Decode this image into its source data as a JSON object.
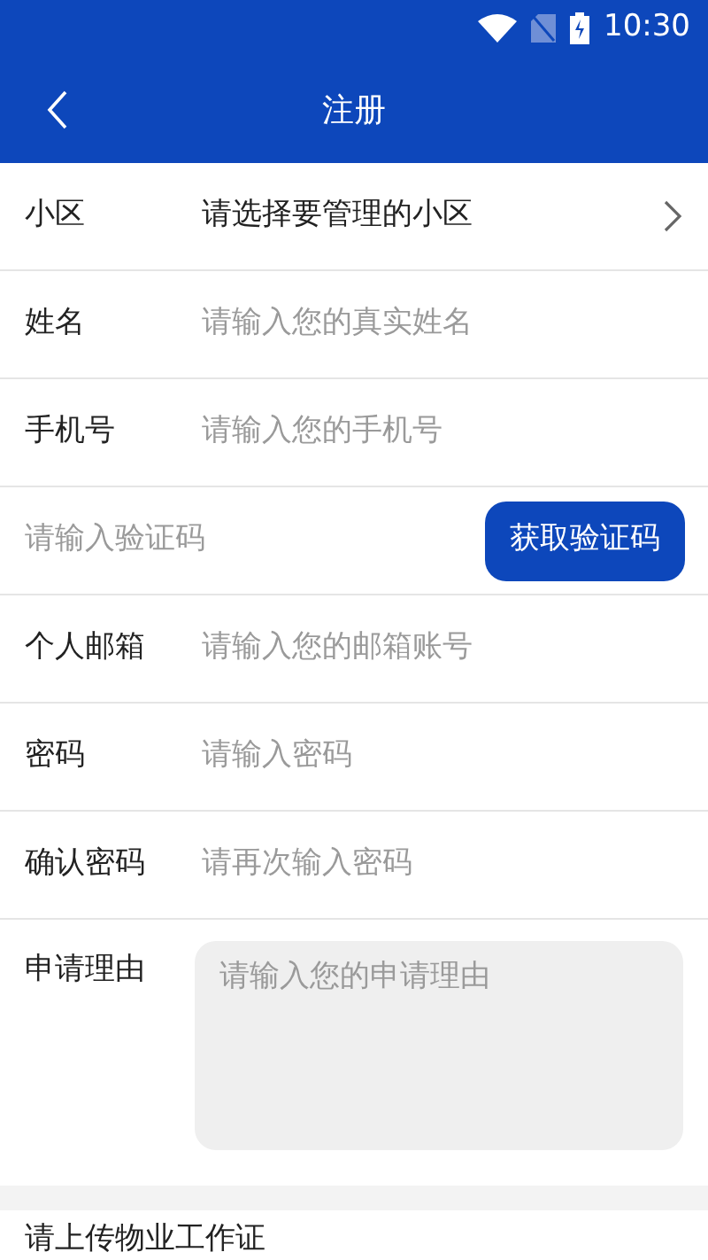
{
  "status_bar": {
    "time": "10:30"
  },
  "header": {
    "title": "注册"
  },
  "fields": [
    {
      "kind": "select",
      "label": "小区",
      "value": "请选择要管理的小区"
    },
    {
      "kind": "input",
      "label": "姓名",
      "placeholder": "请输入您的真实姓名"
    },
    {
      "kind": "input",
      "label": "手机号",
      "placeholder": "请输入您的手机号"
    },
    {
      "kind": "code",
      "placeholder": "请输入验证码",
      "button": "获取验证码"
    },
    {
      "kind": "input",
      "label": "个人邮箱",
      "placeholder": "请输入您的邮箱账号"
    },
    {
      "kind": "input",
      "label": "密码",
      "placeholder": "请输入密码"
    },
    {
      "kind": "input",
      "label": "确认密码",
      "placeholder": "请再次输入密码"
    },
    {
      "kind": "textarea",
      "label": "申请理由",
      "placeholder": "请输入您的申请理由"
    }
  ],
  "upload": {
    "label": "请上传物业工作证"
  }
}
